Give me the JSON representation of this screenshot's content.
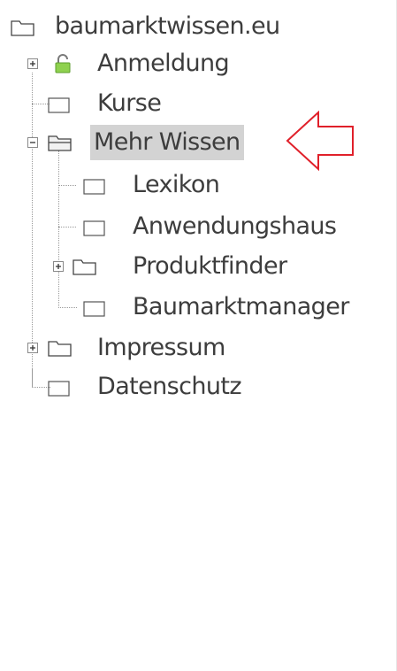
{
  "tree": {
    "root": {
      "label": "baumarktwissen.eu",
      "icon": "folder-icon"
    },
    "items": [
      {
        "label": "Anmeldung",
        "icon": "lock-icon",
        "expandable": true
      },
      {
        "label": "Kurse",
        "icon": "page-icon"
      },
      {
        "label": "Mehr Wissen",
        "icon": "folder-open-icon",
        "expanded": true,
        "selected": true,
        "children": [
          {
            "label": "Lexikon",
            "icon": "page-icon"
          },
          {
            "label": "Anwendungshaus",
            "icon": "page-icon"
          },
          {
            "label": "Produktfinder",
            "icon": "folder-icon",
            "expandable": true
          },
          {
            "label": "Baumarktmanager",
            "icon": "page-icon"
          }
        ]
      },
      {
        "label": "Impressum",
        "icon": "folder-icon",
        "expandable": true
      },
      {
        "label": "Datenschutz",
        "icon": "page-icon"
      }
    ]
  },
  "colors": {
    "text": "#3d3d3d",
    "selected_bg": "#d3d3d3",
    "arrow": "#e0202a",
    "lock": "#8fd14f"
  }
}
